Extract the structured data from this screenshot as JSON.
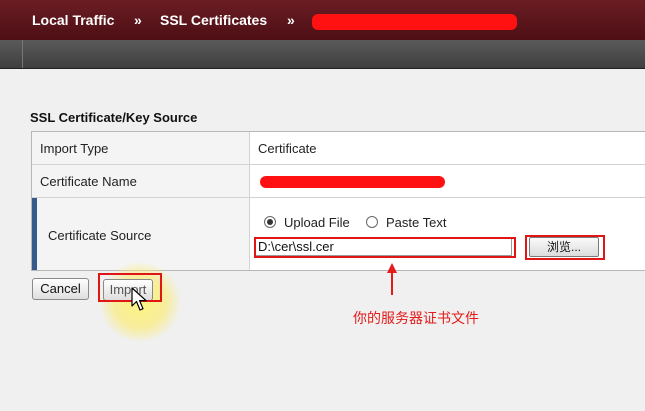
{
  "breadcrumb": {
    "item1": "Local Traffic",
    "item2": "SSL Certificates",
    "separator": "»"
  },
  "section": {
    "title": "SSL Certificate/Key Source"
  },
  "form": {
    "import_type_label": "Import Type",
    "import_type_value": "Certificate",
    "cert_name_label": "Certificate Name",
    "cert_source_label": "Certificate Source",
    "upload_file_label": "Upload File",
    "paste_text_label": "Paste Text",
    "upload_selected": true,
    "file_path": "D:\\cer\\ssl.cer",
    "browse_label": "浏览..."
  },
  "buttons": {
    "cancel": "Cancel",
    "import": "Import"
  },
  "annotation": {
    "text": "你的服务器证书文件"
  },
  "colors": {
    "topbar": "#5a151b",
    "accent": "#355a8c",
    "annotation_red": "#e31b1b"
  }
}
